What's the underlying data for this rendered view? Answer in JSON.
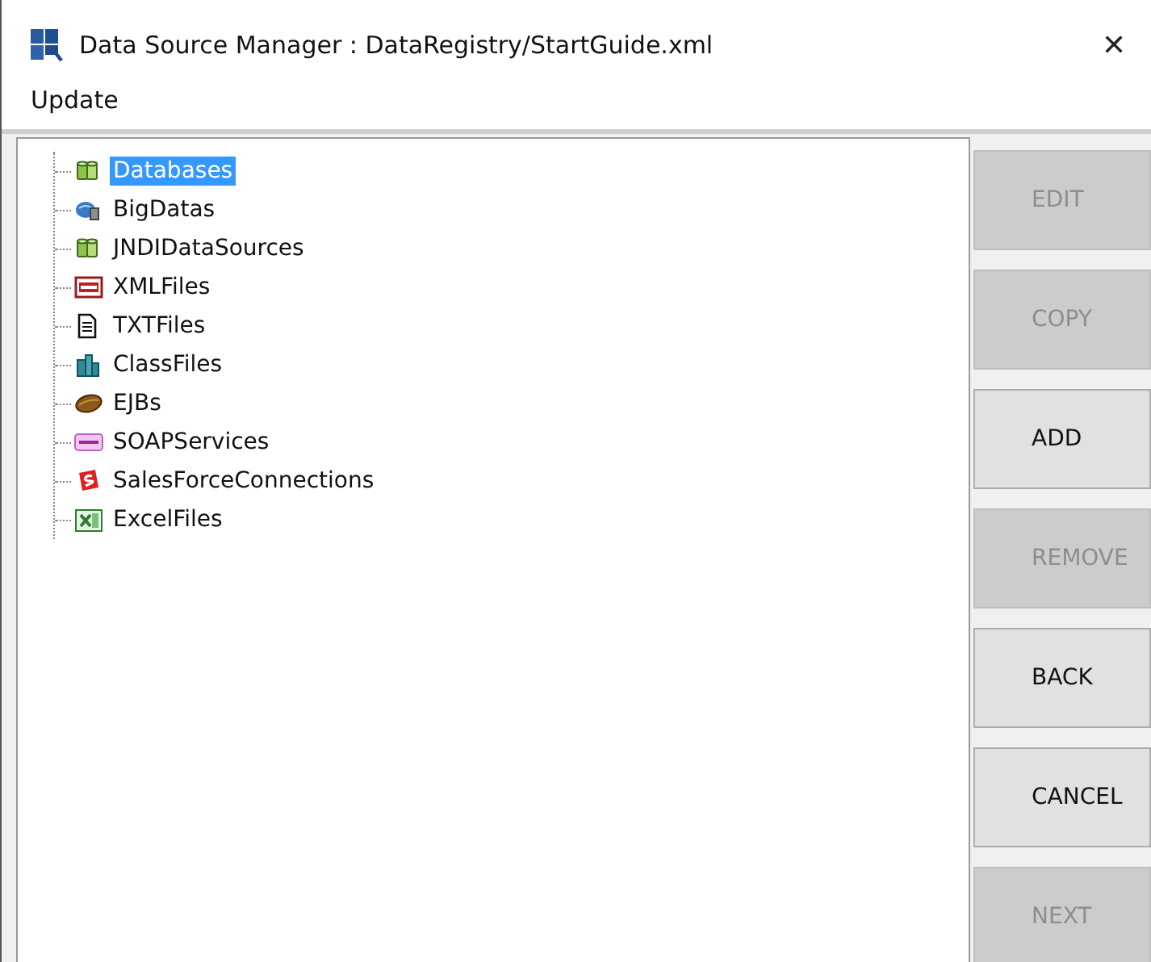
{
  "window": {
    "title": "Data Source Manager : DataRegistry/StartGuide.xml",
    "close": "✕"
  },
  "menu": [
    {
      "label": "Update"
    }
  ],
  "tree": {
    "items": [
      {
        "label": "Databases",
        "kind": "database",
        "selected": true
      },
      {
        "label": "BigDatas",
        "kind": "bigdata",
        "selected": false
      },
      {
        "label": "JNDIDataSources",
        "kind": "database",
        "selected": false
      },
      {
        "label": "XMLFiles",
        "kind": "xml",
        "selected": false
      },
      {
        "label": "TXTFiles",
        "kind": "txt",
        "selected": false
      },
      {
        "label": "ClassFiles",
        "kind": "class",
        "selected": false
      },
      {
        "label": "EJBs",
        "kind": "ejb",
        "selected": false
      },
      {
        "label": "SOAPServices",
        "kind": "soap",
        "selected": false
      },
      {
        "label": "SalesForceConnections",
        "kind": "salesforce",
        "selected": false
      },
      {
        "label": "ExcelFiles",
        "kind": "excel",
        "selected": false
      }
    ]
  },
  "buttons": [
    {
      "label": "EDIT",
      "disabled": true
    },
    {
      "label": "COPY",
      "disabled": true
    },
    {
      "label": "ADD",
      "disabled": false
    },
    {
      "label": "REMOVE",
      "disabled": true
    },
    {
      "label": "BACK",
      "disabled": false
    },
    {
      "label": "CANCEL",
      "disabled": false
    },
    {
      "label": "NEXT",
      "disabled": true
    }
  ]
}
